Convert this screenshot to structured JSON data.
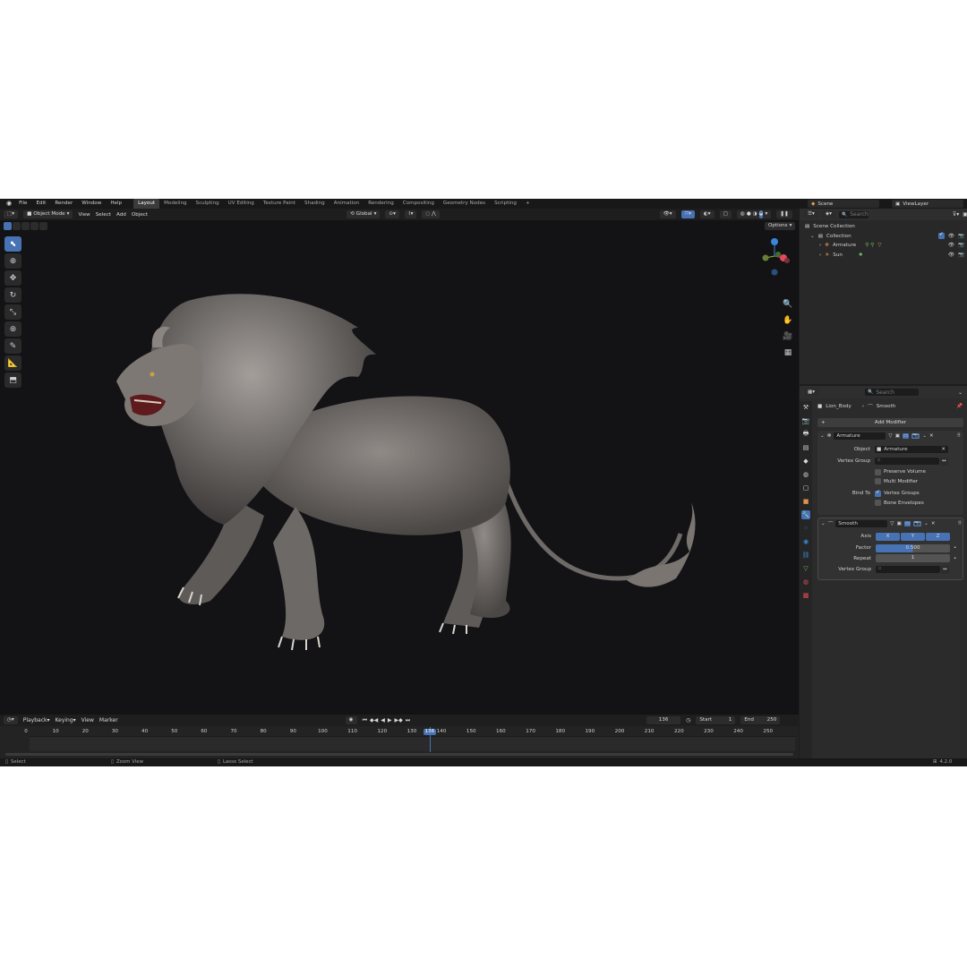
{
  "menu": [
    "File",
    "Edit",
    "Render",
    "Window",
    "Help"
  ],
  "workspaces": [
    "Layout",
    "Modeling",
    "Sculpting",
    "UV Editing",
    "Texture Paint",
    "Shading",
    "Animation",
    "Rendering",
    "Compositing",
    "Geometry Nodes",
    "Scripting"
  ],
  "workspace_add": "+",
  "scene": "Scene",
  "view_layer": "ViewLayer",
  "viewport_header": {
    "mode": "Object Mode",
    "menus": [
      "View",
      "Select",
      "Add",
      "Object"
    ],
    "transform_orientation": "Global",
    "options": "Options"
  },
  "outliner": {
    "search_placeholder": "Search",
    "scene_collection": "Scene Collection",
    "collection": "Collection",
    "items": [
      "Armature",
      "Sun"
    ]
  },
  "properties": {
    "search_placeholder": "Search",
    "object": "Lion_Body",
    "modifier_crumb": "Smooth",
    "add_modifier": "Add Modifier",
    "armature_mod": {
      "name": "Armature",
      "object_label": "Object",
      "object_value": "Armature",
      "vgroup_label": "Vertex Group",
      "preserve_volume": "Preserve Volume",
      "multi_modifier": "Multi Modifier",
      "bind_to": "Bind To",
      "vertex_groups": "Vertex Groups",
      "bone_envelopes": "Bone Envelopes"
    },
    "smooth_mod": {
      "name": "Smooth",
      "axis_label": "Axis",
      "axes": [
        "X",
        "Y",
        "Z"
      ],
      "factor_label": "Factor",
      "factor_value": "0.500",
      "repeat_label": "Repeat",
      "repeat_value": "1",
      "vgroup_label": "Vertex Group"
    }
  },
  "timeline": {
    "menus": [
      "Playback",
      "Keying",
      "View",
      "Marker"
    ],
    "current_frame": "136",
    "start_label": "Start",
    "start_value": "1",
    "end_label": "End",
    "end_value": "250",
    "ticks": [
      "0",
      "10",
      "20",
      "30",
      "40",
      "50",
      "60",
      "70",
      "80",
      "90",
      "100",
      "110",
      "120",
      "130",
      "140",
      "150",
      "160",
      "170",
      "180",
      "190",
      "200",
      "210",
      "220",
      "230",
      "240",
      "250"
    ]
  },
  "status": {
    "select": "Select",
    "zoom_view": "Zoom View",
    "lasso_select": "Lasso Select",
    "version": "4.2.0"
  },
  "colors": {
    "accent": "#4772b3",
    "frame_indicator": "#4772b3",
    "axis_x": "#e04a5a",
    "axis_y": "#7cc33a",
    "axis_z": "#3a86d8",
    "viewport_bg": "#131315"
  }
}
